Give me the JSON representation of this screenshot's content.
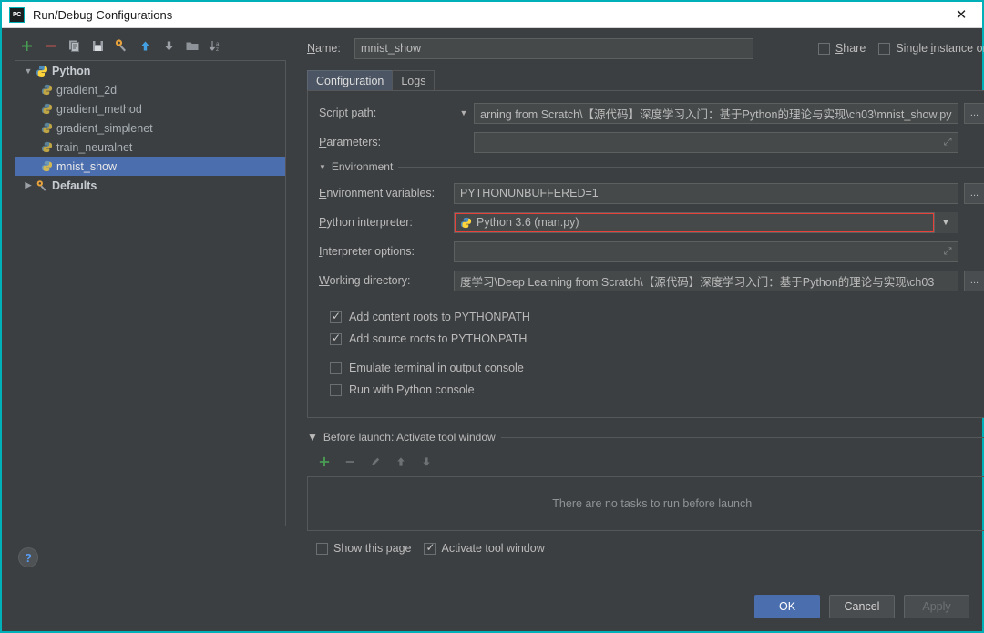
{
  "window": {
    "title": "Run/Debug Configurations",
    "app_icon": "pycharm-icon",
    "close_label": "✕"
  },
  "sidebar": {
    "toolbar": [
      {
        "name": "add-configuration-button",
        "icon": "plus-icon"
      },
      {
        "name": "remove-configuration-button",
        "icon": "minus-icon"
      },
      {
        "name": "copy-configuration-button",
        "icon": "copy-icon"
      },
      {
        "name": "save-configuration-button",
        "icon": "save-icon"
      },
      {
        "name": "edit-defaults-button",
        "icon": "wrench-icon"
      },
      {
        "name": "move-up-button",
        "icon": "arrow-up-icon"
      },
      {
        "name": "move-down-button",
        "icon": "arrow-down-icon"
      },
      {
        "name": "new-folder-button",
        "icon": "folder-icon"
      },
      {
        "name": "sort-alphabetically-button",
        "icon": "sort-az-icon"
      }
    ],
    "tree": [
      {
        "label": "Python",
        "type": "group",
        "expanded": true,
        "icon": "python-icon",
        "selected": false
      },
      {
        "label": "gradient_2d",
        "type": "child",
        "icon": "python-file-icon",
        "selected": false
      },
      {
        "label": "gradient_method",
        "type": "child",
        "icon": "python-file-icon",
        "selected": false
      },
      {
        "label": "gradient_simplenet",
        "type": "child",
        "icon": "python-file-icon",
        "selected": false
      },
      {
        "label": "train_neuralnet",
        "type": "child",
        "icon": "python-file-icon",
        "selected": false
      },
      {
        "label": "mnist_show",
        "type": "child",
        "icon": "python-file-icon",
        "selected": true
      },
      {
        "label": "Defaults",
        "type": "group",
        "expanded": false,
        "icon": "wrench-icon",
        "selected": false
      }
    ],
    "help_label": "?"
  },
  "form": {
    "name_label": "Name:",
    "name_value": "mnist_show",
    "share_label": "Share",
    "share_checked": false,
    "single_instance_label": "Single instance only",
    "single_instance_checked": false,
    "tabs": [
      {
        "label": "Configuration",
        "active": true
      },
      {
        "label": "Logs",
        "active": false
      }
    ],
    "script_path_label": "Script path:",
    "script_path_value": "arning from Scratch\\【源代码】深度学习入门：基于Python的理论与实现\\ch03\\mnist_show.py",
    "parameters_label": "Parameters:",
    "parameters_value": "",
    "environment_section_label": "Environment",
    "env_vars_label": "Environment variables:",
    "env_vars_value": "PYTHONUNBUFFERED=1",
    "interpreter_label": "Python interpreter:",
    "interpreter_value": "Python 3.6 (man.py)",
    "interpreter_highlight_color": "#e8413a",
    "interpreter_options_label": "Interpreter options:",
    "interpreter_options_value": "",
    "working_dir_label": "Working directory:",
    "working_dir_value": "度学习\\Deep Learning from Scratch\\【源代码】深度学习入门：基于Python的理论与实现\\ch03",
    "browse_label": "...",
    "checkboxes": [
      {
        "label": "Add content roots to PYTHONPATH",
        "checked": true,
        "name": "add-content-roots-checkbox"
      },
      {
        "label": "Add source roots to PYTHONPATH",
        "checked": true,
        "name": "add-source-roots-checkbox"
      },
      {
        "label": "Emulate terminal in output console",
        "checked": false,
        "name": "emulate-terminal-checkbox"
      },
      {
        "label": "Run with Python console",
        "checked": false,
        "name": "run-with-console-checkbox"
      }
    ]
  },
  "before_launch": {
    "header": "Before launch: Activate tool window",
    "toolbar": [
      {
        "name": "add-task-button",
        "icon": "plus-icon",
        "enabled": true
      },
      {
        "name": "remove-task-button",
        "icon": "minus-icon",
        "enabled": false
      },
      {
        "name": "edit-task-button",
        "icon": "pencil-icon",
        "enabled": false
      },
      {
        "name": "task-move-up-button",
        "icon": "arrow-up-icon",
        "enabled": false
      },
      {
        "name": "task-move-down-button",
        "icon": "arrow-down-icon",
        "enabled": false
      }
    ],
    "empty_text": "There are no tasks to run before launch",
    "show_page_label": "Show this page",
    "show_page_checked": false,
    "activate_window_label": "Activate tool window",
    "activate_window_checked": true
  },
  "footer": {
    "ok_label": "OK",
    "cancel_label": "Cancel",
    "apply_label": "Apply",
    "apply_enabled": false
  }
}
